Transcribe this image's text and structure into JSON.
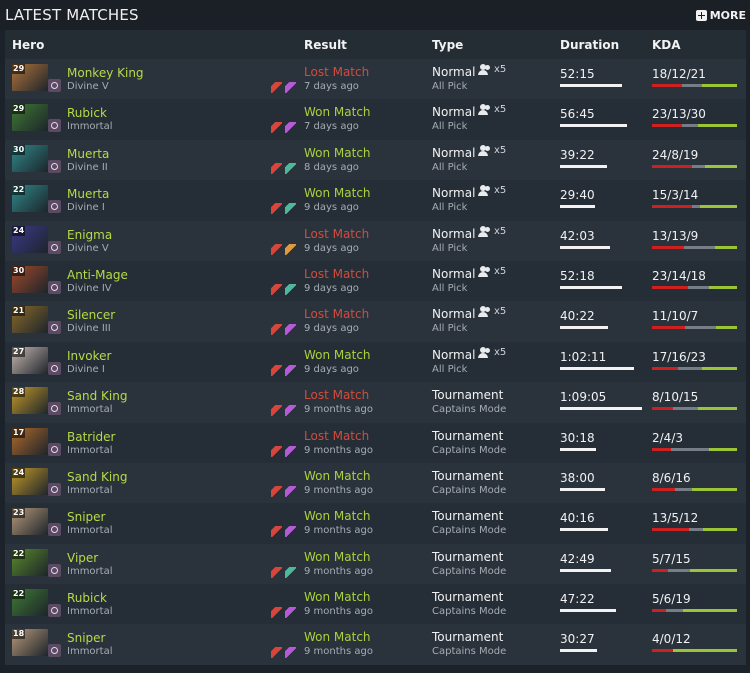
{
  "header": {
    "title": "LATEST MATCHES",
    "more_label": "MORE"
  },
  "columns": {
    "hero": "Hero",
    "result": "Result",
    "type": "Type",
    "duration": "Duration",
    "kda": "KDA"
  },
  "colors": {
    "win": "#a9d23c",
    "loss": "#d24c3c",
    "hero_name": "#b4dc46",
    "kill": "#cf2020",
    "death": "#777d85",
    "assist": "#9ac535"
  },
  "matches": [
    {
      "level": "29",
      "hero": "Monkey King",
      "rank": "Divine V",
      "result": "Lost Match",
      "outcome": "loss",
      "ago": "7 days ago",
      "type": "Normal",
      "party": "x5",
      "mode": "All Pick",
      "duration": "52:15",
      "duration_pct": 0.73,
      "kda": "18/12/21",
      "k": 18,
      "d": 12,
      "a": 21,
      "hero_color": "#b0743a",
      "items": [
        "red-item-icon",
        "purple-item-icon"
      ]
    },
    {
      "level": "29",
      "hero": "Rubick",
      "rank": "Immortal",
      "result": "Won Match",
      "outcome": "win",
      "ago": "7 days ago",
      "type": "Normal",
      "party": "x5",
      "mode": "All Pick",
      "duration": "56:45",
      "duration_pct": 0.79,
      "kda": "23/13/30",
      "k": 23,
      "d": 13,
      "a": 30,
      "hero_color": "#3f7a33",
      "items": [
        "red-item-icon",
        "purple-item-icon"
      ]
    },
    {
      "level": "30",
      "hero": "Muerta",
      "rank": "Divine II",
      "result": "Won Match",
      "outcome": "win",
      "ago": "8 days ago",
      "type": "Normal",
      "party": "x5",
      "mode": "All Pick",
      "duration": "39:22",
      "duration_pct": 0.55,
      "kda": "24/8/19",
      "k": 24,
      "d": 8,
      "a": 19,
      "hero_color": "#2f8a8a",
      "items": [
        "red-item-icon",
        "green-item-icon"
      ]
    },
    {
      "level": "22",
      "hero": "Muerta",
      "rank": "Divine I",
      "result": "Won Match",
      "outcome": "win",
      "ago": "9 days ago",
      "type": "Normal",
      "party": "x5",
      "mode": "All Pick",
      "duration": "29:40",
      "duration_pct": 0.41,
      "kda": "15/3/14",
      "k": 15,
      "d": 3,
      "a": 14,
      "hero_color": "#2f8a8a",
      "items": [
        "red-item-icon",
        "green-item-icon"
      ]
    },
    {
      "level": "24",
      "hero": "Enigma",
      "rank": "Divine V",
      "result": "Lost Match",
      "outcome": "loss",
      "ago": "9 days ago",
      "type": "Normal",
      "party": "x5",
      "mode": "All Pick",
      "duration": "42:03",
      "duration_pct": 0.59,
      "kda": "13/13/9",
      "k": 13,
      "d": 13,
      "a": 9,
      "hero_color": "#3b3a8a",
      "items": [
        "red-item-icon",
        "orange-item-icon"
      ]
    },
    {
      "level": "30",
      "hero": "Anti-Mage",
      "rank": "Divine IV",
      "result": "Lost Match",
      "outcome": "loss",
      "ago": "9 days ago",
      "type": "Normal",
      "party": "x5",
      "mode": "All Pick",
      "duration": "52:18",
      "duration_pct": 0.73,
      "kda": "23/14/18",
      "k": 23,
      "d": 14,
      "a": 18,
      "hero_color": "#a0492a",
      "items": [
        "red-item-icon",
        "green-item-icon"
      ]
    },
    {
      "level": "21",
      "hero": "Silencer",
      "rank": "Divine III",
      "result": "Lost Match",
      "outcome": "loss",
      "ago": "9 days ago",
      "type": "Normal",
      "party": "x5",
      "mode": "All Pick",
      "duration": "40:22",
      "duration_pct": 0.56,
      "kda": "11/10/7",
      "k": 11,
      "d": 10,
      "a": 7,
      "hero_color": "#8a6a2a",
      "items": [
        "red-item-icon",
        "purple-item-icon"
      ]
    },
    {
      "level": "27",
      "hero": "Invoker",
      "rank": "Divine I",
      "result": "Won Match",
      "outcome": "win",
      "ago": "9 days ago",
      "type": "Normal",
      "party": "x5",
      "mode": "All Pick",
      "duration": "1:02:11",
      "duration_pct": 0.87,
      "kda": "17/16/23",
      "k": 17,
      "d": 16,
      "a": 23,
      "hero_color": "#c8b8b0",
      "items": [
        "red-item-icon",
        "purple-item-icon"
      ]
    },
    {
      "level": "28",
      "hero": "Sand King",
      "rank": "Immortal",
      "result": "Lost Match",
      "outcome": "loss",
      "ago": "9 months ago",
      "type": "Tournament",
      "party": "",
      "mode": "Captains Mode",
      "duration": "1:09:05",
      "duration_pct": 0.96,
      "kda": "8/10/15",
      "k": 8,
      "d": 10,
      "a": 15,
      "hero_color": "#c49a2a",
      "items": [
        "red-item-icon",
        "purple-item-icon"
      ]
    },
    {
      "level": "17",
      "hero": "Batrider",
      "rank": "Immortal",
      "result": "Lost Match",
      "outcome": "loss",
      "ago": "9 months ago",
      "type": "Tournament",
      "party": "",
      "mode": "Captains Mode",
      "duration": "30:18",
      "duration_pct": 0.42,
      "kda": "2/4/3",
      "k": 2,
      "d": 4,
      "a": 3,
      "hero_color": "#b06a2a",
      "items": [
        "red-item-icon",
        "purple-item-icon"
      ]
    },
    {
      "level": "24",
      "hero": "Sand King",
      "rank": "Immortal",
      "result": "Won Match",
      "outcome": "win",
      "ago": "9 months ago",
      "type": "Tournament",
      "party": "",
      "mode": "Captains Mode",
      "duration": "38:00",
      "duration_pct": 0.53,
      "kda": "8/6/16",
      "k": 8,
      "d": 6,
      "a": 16,
      "hero_color": "#c49a2a",
      "items": [
        "red-item-icon",
        "purple-item-icon"
      ]
    },
    {
      "level": "23",
      "hero": "Sniper",
      "rank": "Immortal",
      "result": "Won Match",
      "outcome": "win",
      "ago": "9 months ago",
      "type": "Tournament",
      "party": "",
      "mode": "Captains Mode",
      "duration": "40:16",
      "duration_pct": 0.56,
      "kda": "13/5/12",
      "k": 13,
      "d": 5,
      "a": 12,
      "hero_color": "#b89a7a",
      "items": [
        "red-item-icon",
        "purple-item-icon"
      ]
    },
    {
      "level": "22",
      "hero": "Viper",
      "rank": "Immortal",
      "result": "Won Match",
      "outcome": "win",
      "ago": "9 months ago",
      "type": "Tournament",
      "party": "",
      "mode": "Captains Mode",
      "duration": "42:49",
      "duration_pct": 0.6,
      "kda": "5/7/15",
      "k": 5,
      "d": 7,
      "a": 15,
      "hero_color": "#5a8a2a",
      "items": [
        "red-item-icon",
        "green-item-icon"
      ]
    },
    {
      "level": "22",
      "hero": "Rubick",
      "rank": "Immortal",
      "result": "Won Match",
      "outcome": "win",
      "ago": "9 months ago",
      "type": "Tournament",
      "party": "",
      "mode": "Captains Mode",
      "duration": "47:22",
      "duration_pct": 0.66,
      "kda": "5/6/19",
      "k": 5,
      "d": 6,
      "a": 19,
      "hero_color": "#3f7a33",
      "items": [
        "red-item-icon",
        "purple-item-icon"
      ]
    },
    {
      "level": "18",
      "hero": "Sniper",
      "rank": "Immortal",
      "result": "Won Match",
      "outcome": "win",
      "ago": "9 months ago",
      "type": "Tournament",
      "party": "",
      "mode": "Captains Mode",
      "duration": "30:27",
      "duration_pct": 0.43,
      "kda": "4/0/12",
      "k": 4,
      "d": 0,
      "a": 12,
      "hero_color": "#b89a7a",
      "items": [
        "red-item-icon",
        "purple-item-icon"
      ]
    }
  ]
}
